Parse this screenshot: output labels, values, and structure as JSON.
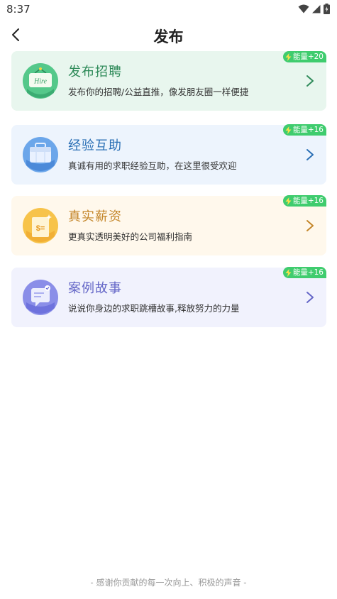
{
  "status_bar": {
    "time": "8:37",
    "icons": [
      "wifi-icon",
      "signal-icon",
      "battery-icon"
    ]
  },
  "header": {
    "title": "发布",
    "back_icon": "chevron-left-icon"
  },
  "cards": [
    {
      "id": "recruit",
      "title": "发布招聘",
      "desc": "发布你的招聘/公益直推，像发朋友圈一样便捷",
      "badge": "能量+20",
      "icon_text": "Hire",
      "accent": "#2e8a59"
    },
    {
      "id": "experience",
      "title": "经验互助",
      "desc": "真诚有用的求职经验互助，在这里很受欢迎",
      "badge": "能量+16",
      "accent": "#2a6fb5"
    },
    {
      "id": "salary",
      "title": "真实薪资",
      "desc": "更真实透明美好的公司福利指南",
      "badge": "能量+16",
      "icon_text": "$=",
      "accent": "#c4862a"
    },
    {
      "id": "story",
      "title": "案例故事",
      "desc": "说说你身边的求职跳槽故事,释放努力的力量",
      "badge": "能量+16",
      "accent": "#6466c7"
    }
  ],
  "footer": {
    "text": "- 感谢你贡献的每一次向上、积极的声音 -"
  },
  "colors": {
    "badge": "#3fcc6e",
    "green_bg": "#e8f6ee",
    "blue_bg": "#edf4fd",
    "yellow_bg": "#fff8ec",
    "purple_bg": "#f1f2fd"
  }
}
